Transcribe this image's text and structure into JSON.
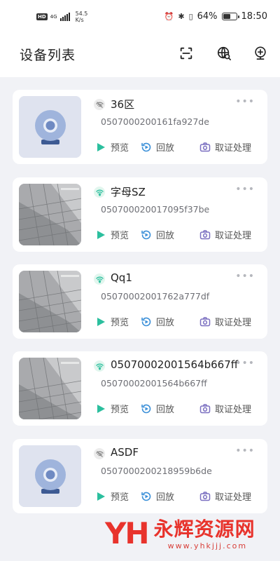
{
  "status_bar": {
    "network_badge": "HD",
    "network_type": "4G",
    "speed_value": "54.5",
    "speed_unit": "K/s",
    "battery": "64%",
    "battery_level": 0.64,
    "time": "18:50"
  },
  "header": {
    "title": "设备列表",
    "icons": [
      "scan-icon",
      "globe-search-icon",
      "add-camera-icon"
    ]
  },
  "devices": [
    {
      "name": "36区",
      "id": "0507000200161fa927de",
      "status": "offline",
      "thumbnail": "camera-placeholder",
      "more": "•••"
    },
    {
      "name": "字母SZ",
      "id": "050700020017095f37be",
      "status": "online",
      "thumbnail": "snapshot",
      "more": "•••"
    },
    {
      "name": "Qq1",
      "id": "05070002001762a777df",
      "status": "online",
      "thumbnail": "snapshot",
      "more": "•••"
    },
    {
      "name": "05070002001564b667ff",
      "id": "05070002001564b667ff",
      "status": "online",
      "thumbnail": "snapshot",
      "more": "•••"
    },
    {
      "name": "ASDF",
      "id": "0507000200218959b6de",
      "status": "offline",
      "thumbnail": "camera-placeholder",
      "more": "•••"
    }
  ],
  "actions": {
    "preview": "预览",
    "playback": "回放",
    "evidence": "取证处理"
  },
  "colors": {
    "accent": "#2bbf9e",
    "playback_blue": "#3a8fd8",
    "evidence_purple": "#7a6fc0",
    "background": "#f1f2f6",
    "watermark_red": "#e8332c"
  },
  "watermark": {
    "logo": "YH",
    "name": "永辉资源网",
    "url": "www.yhkjjj.com"
  }
}
